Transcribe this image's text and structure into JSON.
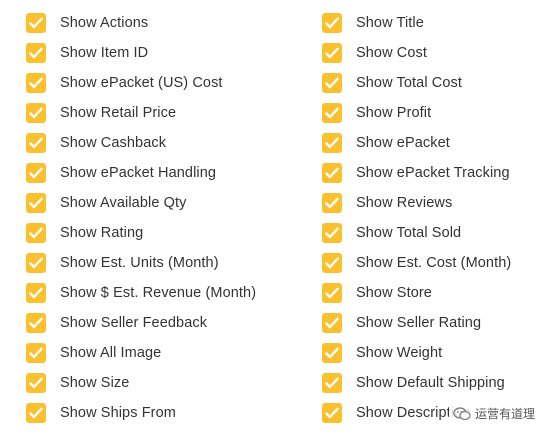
{
  "theme": {
    "checkbox_color": "#fbc02d",
    "check_color": "#ffffff",
    "text_color": "#333333"
  },
  "left_column": [
    {
      "label": "Show Actions",
      "checked": true
    },
    {
      "label": "Show Item ID",
      "checked": true
    },
    {
      "label": "Show ePacket (US) Cost",
      "checked": true
    },
    {
      "label": "Show Retail Price",
      "checked": true
    },
    {
      "label": "Show Cashback",
      "checked": true
    },
    {
      "label": "Show ePacket Handling",
      "checked": true
    },
    {
      "label": "Show Available Qty",
      "checked": true
    },
    {
      "label": "Show Rating",
      "checked": true
    },
    {
      "label": "Show Est. Units (Month)",
      "checked": true
    },
    {
      "label": "Show $ Est. Revenue (Month)",
      "checked": true
    },
    {
      "label": "Show Seller Feedback",
      "checked": true
    },
    {
      "label": "Show All Image",
      "checked": true
    },
    {
      "label": "Show Size",
      "checked": true
    },
    {
      "label": "Show Ships From",
      "checked": true
    }
  ],
  "right_column": [
    {
      "label": "Show Title",
      "checked": true
    },
    {
      "label": "Show Cost",
      "checked": true
    },
    {
      "label": "Show Total Cost",
      "checked": true
    },
    {
      "label": "Show Profit",
      "checked": true
    },
    {
      "label": "Show ePacket",
      "checked": true
    },
    {
      "label": "Show ePacket Tracking",
      "checked": true
    },
    {
      "label": "Show Reviews",
      "checked": true
    },
    {
      "label": "Show Total Sold",
      "checked": true
    },
    {
      "label": "Show Est. Cost (Month)",
      "checked": true
    },
    {
      "label": "Show Store",
      "checked": true
    },
    {
      "label": "Show Seller Rating",
      "checked": true
    },
    {
      "label": "Show Weight",
      "checked": true
    },
    {
      "label": "Show Default Shipping",
      "checked": true
    },
    {
      "label": "Show Description",
      "checked": true
    }
  ],
  "watermark": {
    "text": "运营有道理",
    "icon": "wechat-icon"
  }
}
